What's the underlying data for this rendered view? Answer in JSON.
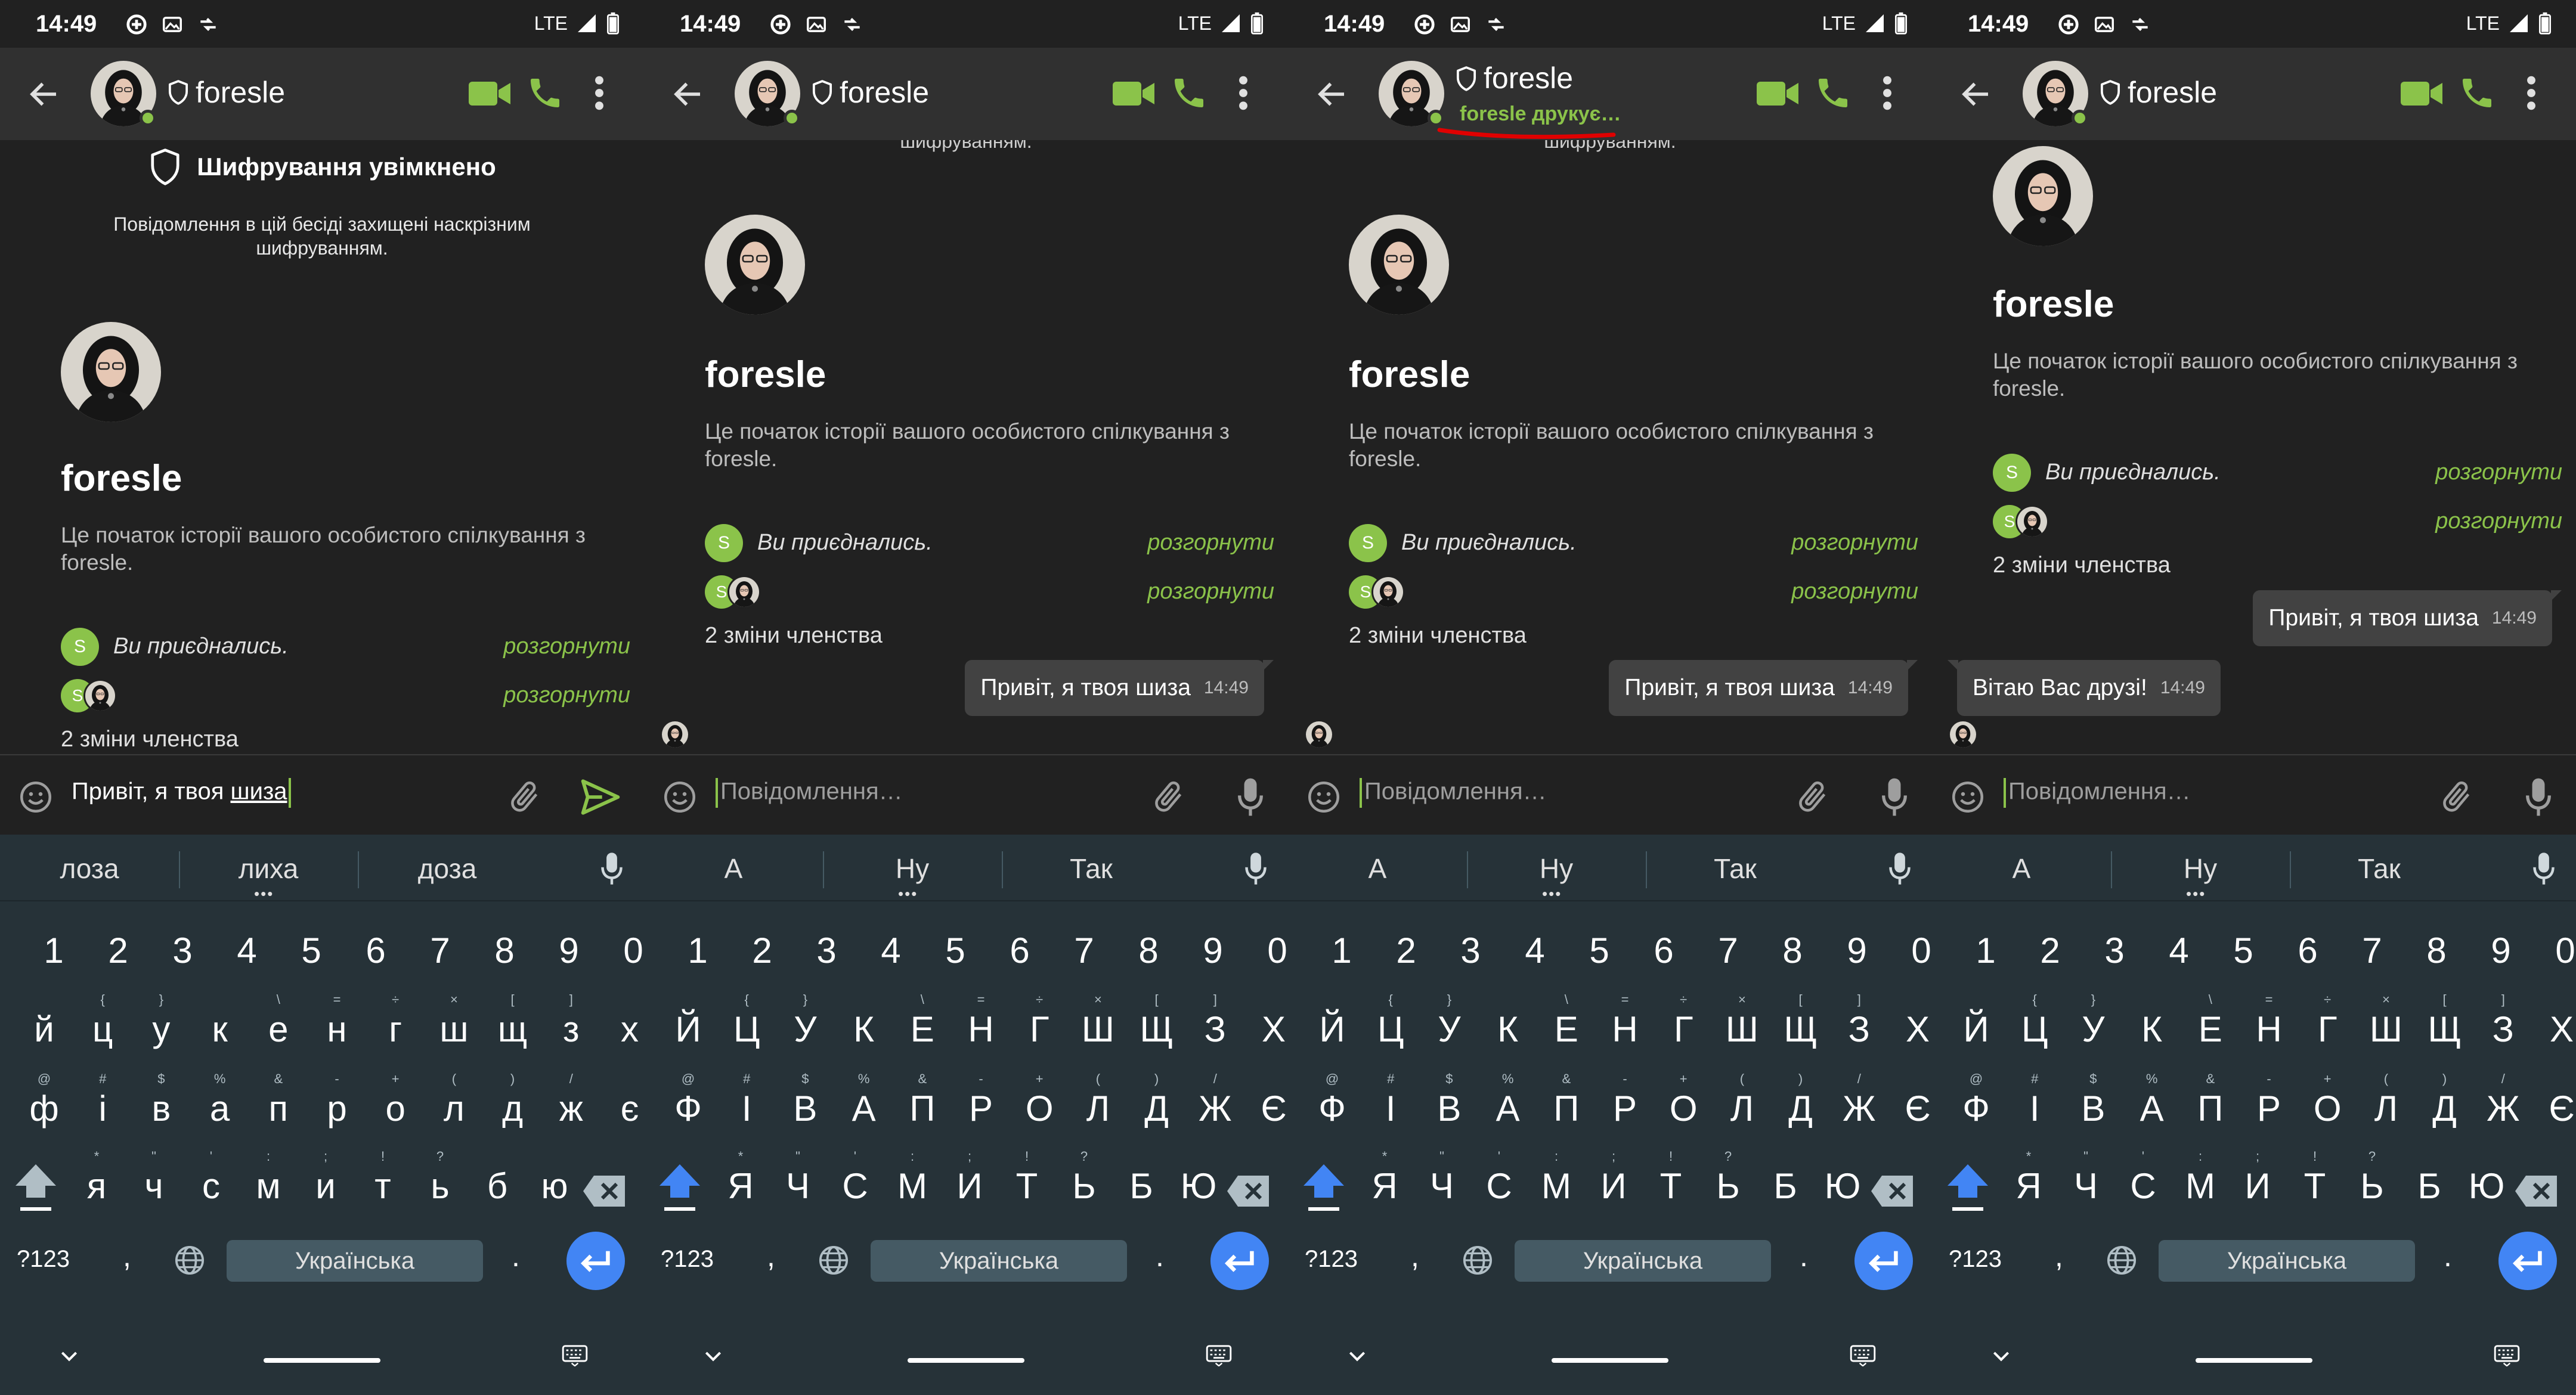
{
  "colors": {
    "accent": "#8bc34a",
    "app_bg": "#212121",
    "appbar_bg": "#303030",
    "keyboard_bg": "#263238",
    "bubble_bg": "#424242",
    "enter_key": "#4285f4",
    "annotation": "#e00000"
  },
  "status_bar": {
    "time": "14:49",
    "network": "LTE"
  },
  "chat": {
    "name": "foresle",
    "typing": "foresle друкує…"
  },
  "encryption": {
    "title": "Шифрування увімкнено",
    "description": "Повідомлення в цій бесіді захищені наскрізним шифруванням.",
    "partial": "шифруванням."
  },
  "room": {
    "name": "foresle",
    "intro": "Це початок історії вашого особистого спілкування з foresle."
  },
  "events": {
    "joined_badge": "S",
    "joined": "Ви приєднались.",
    "expand": "розгорнути",
    "membership": "2 зміни членства"
  },
  "messages": {
    "outgoing": {
      "text": "Привіт, я твоя шиза",
      "time": "14:49"
    },
    "incoming": {
      "text": "Вітаю Вас друзі!",
      "time": "14:49"
    }
  },
  "composer": {
    "placeholder": "Повідомлення…",
    "typed_prefix": "Привіт, я твоя ",
    "typed_word": "шиза"
  },
  "keyboard": {
    "suggestions_typing": [
      "лоза",
      "лиха",
      "доза"
    ],
    "suggestions_default": [
      "А",
      "Ну",
      "Так"
    ],
    "dots": "•••",
    "numbers": [
      "1",
      "2",
      "3",
      "4",
      "5",
      "6",
      "7",
      "8",
      "9",
      "0"
    ],
    "row1_hints": [
      "",
      "{",
      "}",
      "",
      "\\",
      "=",
      "÷",
      "×",
      "[",
      "]",
      ""
    ],
    "row2_hints": [
      "@",
      "#",
      "$",
      "%",
      "&",
      "-",
      "+",
      "(",
      ")",
      "/",
      ""
    ],
    "row3_hints": [
      "*",
      "\"",
      "'",
      ":",
      ";",
      "!",
      "?"
    ],
    "rows_lower": [
      [
        "й",
        "ц",
        "у",
        "к",
        "е",
        "н",
        "г",
        "ш",
        "щ",
        "з",
        "х"
      ],
      [
        "ф",
        "і",
        "в",
        "а",
        "п",
        "р",
        "о",
        "л",
        "д",
        "ж",
        "є"
      ],
      [
        "я",
        "ч",
        "с",
        "м",
        "и",
        "т",
        "ь",
        "б",
        "ю"
      ]
    ],
    "rows_upper": [
      [
        "Й",
        "Ц",
        "У",
        "К",
        "Е",
        "Н",
        "Г",
        "Ш",
        "Щ",
        "З",
        "Х"
      ],
      [
        "Ф",
        "І",
        "В",
        "А",
        "П",
        "Р",
        "О",
        "Л",
        "Д",
        "Ж",
        "Є"
      ],
      [
        "Я",
        "Ч",
        "С",
        "М",
        "И",
        "Т",
        "Ь",
        "Б",
        "Ю"
      ]
    ],
    "symbols_key": "?123",
    "comma": ",",
    "period": ".",
    "space_label": "Українська"
  },
  "screens": [
    {
      "variant": "composing",
      "keyboard_case": "lower"
    },
    {
      "variant": "sent",
      "keyboard_case": "upper"
    },
    {
      "variant": "typing",
      "keyboard_case": "upper"
    },
    {
      "variant": "received",
      "keyboard_case": "upper"
    }
  ]
}
